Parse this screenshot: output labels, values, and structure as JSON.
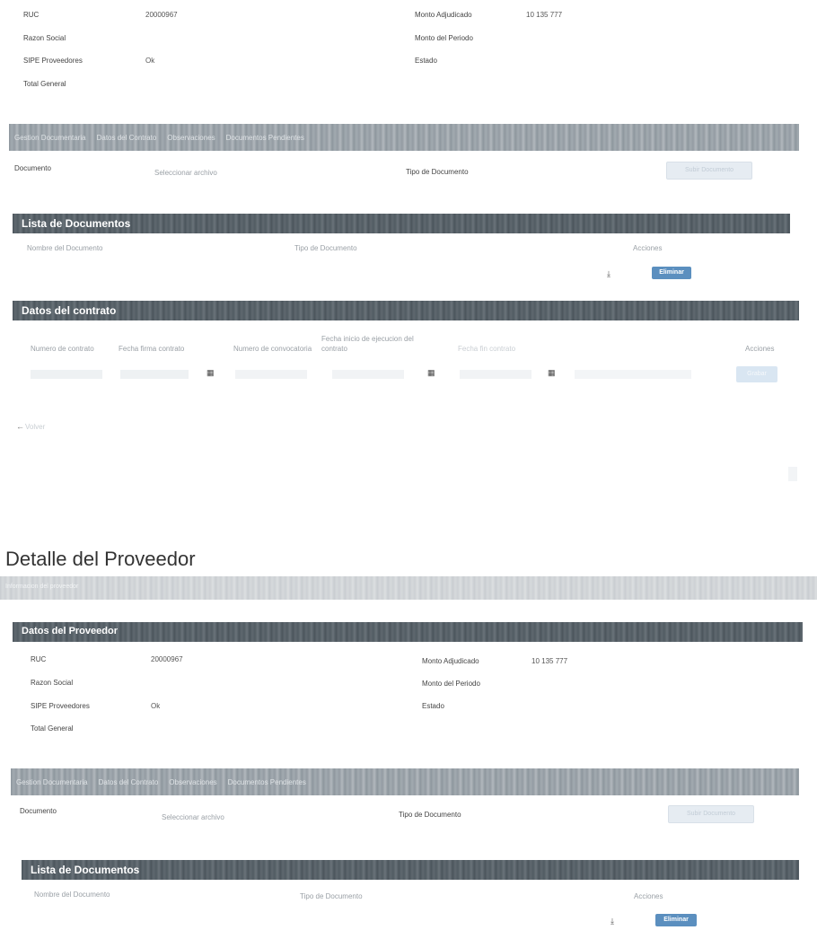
{
  "top_summary": {
    "ruc_label": "RUC",
    "ruc_value": "20000967",
    "monto_adjudicado_label": "Monto Adjudicado",
    "monto_adjudicado_value": "10 135 777",
    "razon_social_label": "Razon Social",
    "razon_social_value": "",
    "monto_periodo_label": "Monto del Periodo",
    "monto_periodo_value": "",
    "sipe_label": "SIPE Proveedores",
    "sipe_value": "Ok",
    "estado_label": "Estado",
    "estado_value": "",
    "total_label": "Total General",
    "total_value": ""
  },
  "top_tabs": [
    "Gestion Documentaria",
    "Datos del Contrato",
    "Observaciones",
    "Documentos Pendientes"
  ],
  "top_upload": {
    "documento_label": "Documento",
    "select_label": "Seleccionar archivo",
    "tipo_label": "Tipo de Documento",
    "button_label": "Subir Documento"
  },
  "top_doc_list": {
    "title": "Lista de Documentos",
    "col_name": "Nombre del Documento",
    "col_tipo": "Tipo de Documento",
    "col_acciones": "Acciones",
    "row_name": "",
    "row_tipo": "",
    "row_button": "Eliminar"
  },
  "contract": {
    "title": "Datos del contrato",
    "col_numero": "Numero de contrato",
    "col_fecha_firma": "Fecha firma contrato",
    "col_numero_convocatoria": "Numero de convocatoria",
    "col_fecha_inicio": "Fecha inicio de ejecucion del contrato",
    "col_fecha_fin": "Fecha fin contrato",
    "col_fecha_conformidad": "",
    "col_acciones": "Acciones",
    "button_label": "Grabar",
    "back_label": "Volver"
  },
  "page_title": "Detalle del Proveedor",
  "subtitle_bar": "Informacion del proveedor",
  "provider": {
    "title": "Datos del Proveedor",
    "ruc_label": "RUC",
    "ruc_value": "20000967",
    "monto_adjudicado_label": "Monto Adjudicado",
    "monto_adjudicado_value": "10 135 777",
    "razon_social_label": "Razon Social",
    "razon_social_value": "",
    "monto_periodo_label": "Monto del Periodo",
    "monto_periodo_value": "",
    "sipe_label": "SIPE Proveedores",
    "sipe_value": "Ok",
    "estado_label": "Estado",
    "estado_value": "",
    "total_label": "Total General",
    "total_value": ""
  },
  "bottom_tabs": [
    "Gestion Documentaria",
    "Datos del Contrato",
    "Observaciones",
    "Documentos Pendientes"
  ],
  "bottom_upload": {
    "documento_label": "Documento",
    "select_label": "Seleccionar archivo",
    "tipo_label": "Tipo de Documento",
    "button_label": "Subir Documento"
  },
  "bottom_doc_list": {
    "title": "Lista de Documentos",
    "col_name": "Nombre del Documento",
    "col_tipo": "Tipo de Documento",
    "col_acciones": "Acciones",
    "row_name": "",
    "row_tipo": "",
    "row_button": "Eliminar"
  },
  "icons": {
    "calendar": "calendar-icon",
    "back": "arrow-left-icon",
    "download": "download-icon"
  }
}
